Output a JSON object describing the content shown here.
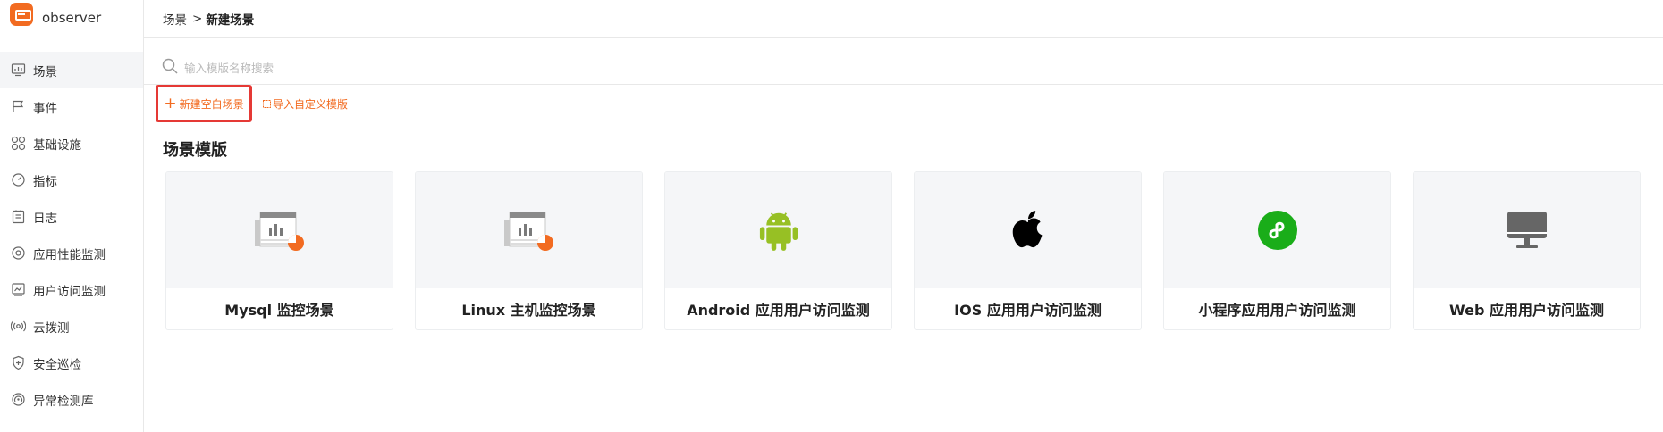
{
  "brand": {
    "name": "observer",
    "accent": "#f26b21"
  },
  "sidebar": {
    "items": [
      {
        "label": "场景",
        "icon": "dashboard-icon",
        "active": true
      },
      {
        "label": "事件",
        "icon": "flag-icon"
      },
      {
        "label": "基础设施",
        "icon": "grid-icon"
      },
      {
        "label": "指标",
        "icon": "gauge-icon"
      },
      {
        "label": "日志",
        "icon": "log-icon"
      },
      {
        "label": "应用性能监测",
        "icon": "target-icon"
      },
      {
        "label": "用户访问监测",
        "icon": "chart-frame-icon"
      },
      {
        "label": "云拨测",
        "icon": "signal-icon"
      },
      {
        "label": "安全巡检",
        "icon": "shield-icon"
      },
      {
        "label": "异常检测库",
        "icon": "radar-icon"
      }
    ]
  },
  "breadcrumb": {
    "parent": "场景",
    "separator": ">",
    "current": "新建场景"
  },
  "search": {
    "placeholder": "输入模版名称搜索",
    "value": ""
  },
  "actions": {
    "new_blank": "新建空白场景",
    "import_custom": "导入自定义模版",
    "highlight_color": "#e53935"
  },
  "section": {
    "title": "场景模版"
  },
  "templates": [
    {
      "label": "Mysql 监控场景",
      "icon": "report-chart-icon"
    },
    {
      "label": "Linux 主机监控场景",
      "icon": "report-chart-icon"
    },
    {
      "label": "Android 应用用户访问监测",
      "icon": "android-icon",
      "color": "#97c024"
    },
    {
      "label": "IOS 应用用户访问监测",
      "icon": "apple-icon",
      "color": "#000000"
    },
    {
      "label": "小程序应用用户访问监测",
      "icon": "mini-program-icon",
      "color": "#1aad19"
    },
    {
      "label": "Web 应用用户访问监测",
      "icon": "monitor-icon",
      "color": "#666666"
    }
  ]
}
